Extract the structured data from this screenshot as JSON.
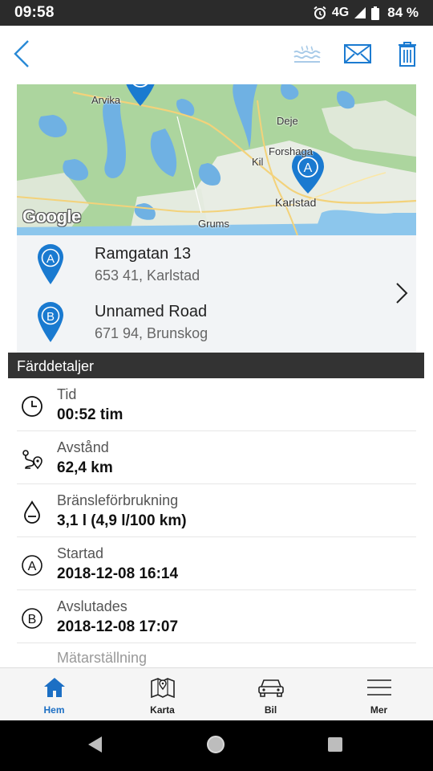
{
  "status_bar": {
    "time": "09:58",
    "network": "4G",
    "battery": "84 %"
  },
  "top_bar": {
    "back_icon": "chevron-left-icon",
    "actions": [
      "heat-icon",
      "mail-icon",
      "trash-icon"
    ]
  },
  "map": {
    "labels": {
      "arvika": "Arvika",
      "deje": "Deje",
      "forshaga": "Forshaga",
      "kil": "Kil",
      "karlstad": "Karlstad",
      "grums": "Grums"
    },
    "google": "Google",
    "pin_a": "A",
    "pin_b": "B"
  },
  "route": {
    "start": {
      "marker": "A",
      "line1": "Ramgatan 13",
      "line2": "653 41, Karlstad"
    },
    "end": {
      "marker": "B",
      "line1": "Unnamed Road",
      "line2": "671 94, Brunskog"
    }
  },
  "details": {
    "header": "Färddetaljer",
    "rows": [
      {
        "icon": "clock-icon",
        "label": "Tid",
        "value": "00:52 tim"
      },
      {
        "icon": "route-icon",
        "label": "Avstånd",
        "value": "62,4 km"
      },
      {
        "icon": "fuel-drop-icon",
        "label": "Bränsleförbrukning",
        "value": "3,1 l (4,9 l/100 km)"
      },
      {
        "icon": "marker-a-icon",
        "marker": "A",
        "label": "Startad",
        "value": "2018-12-08 16:14"
      },
      {
        "icon": "marker-b-icon",
        "marker": "B",
        "label": "Avslutades",
        "value": "2018-12-08 17:07"
      },
      {
        "label": "Mätarställning"
      }
    ]
  },
  "bottom_nav": {
    "items": [
      {
        "label": "Hem",
        "icon": "home-icon",
        "active": true
      },
      {
        "label": "Karta",
        "icon": "map-icon",
        "active": false
      },
      {
        "label": "Bil",
        "icon": "car-icon",
        "active": false
      },
      {
        "label": "Mer",
        "icon": "menu-icon",
        "active": false
      }
    ]
  },
  "colors": {
    "accent": "#1c6fc4",
    "pin": "#1a7ad0",
    "header_bg": "#333333",
    "status_bar": "#2b2b2b"
  }
}
